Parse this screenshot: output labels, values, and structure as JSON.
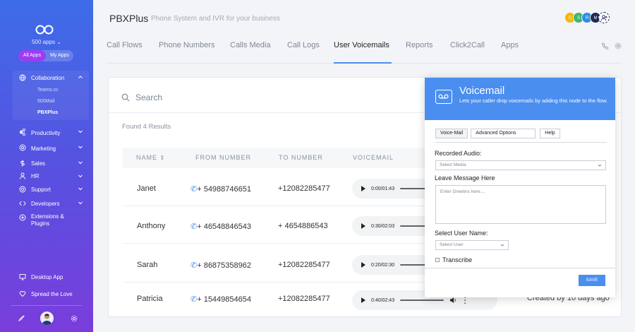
{
  "sidebar": {
    "apps_label": "500 apps",
    "pills": [
      "All Apps",
      "My Apps"
    ],
    "collaboration": "Collaboration",
    "collab_sub": [
      "Teams.cc",
      "500Mail",
      "PBXPlus"
    ],
    "items": [
      {
        "label": "Productivity",
        "icon": "command-icon"
      },
      {
        "label": "Marketing",
        "icon": "target-icon"
      },
      {
        "label": "Sales",
        "icon": "dollar-icon"
      },
      {
        "label": "HR",
        "icon": "user-icon"
      },
      {
        "label": "Support",
        "icon": "lifebuoy-icon"
      },
      {
        "label": "Developers",
        "icon": "code-icon"
      },
      {
        "label": "Extensions & Plugins",
        "icon": "puzzle-icon"
      }
    ],
    "bottom": [
      {
        "label": "Desktop App",
        "icon": "monitor-icon"
      },
      {
        "label": "Spread the Love",
        "icon": "heart-icon"
      }
    ]
  },
  "header": {
    "brand": "PBXPlus",
    "tagline": "Phone System and IVR for your business",
    "bubbles": [
      {
        "letter": "C",
        "color": "#f5b800"
      },
      {
        "letter": "S",
        "color": "#3fb66f"
      },
      {
        "letter": "R",
        "color": "#2e8de6"
      },
      {
        "letter": "M",
        "color": "#1f2a5a"
      }
    ]
  },
  "tabs": [
    "Call Flows",
    "Phone Numbers",
    "Calls Media",
    "Call Logs",
    "User Voicemails",
    "Reports",
    "Click2Call",
    "Apps"
  ],
  "main": {
    "search_placeholder": "Search",
    "results": "Found 4 Results",
    "columns": [
      "NAME",
      "FROM NUMBER",
      "TO NUMBER",
      "VOICEMAIL"
    ],
    "rows": [
      {
        "name": "Janet",
        "from": "+ 54988746651",
        "to": "+12082285477",
        "time": "0:00/01:43"
      },
      {
        "name": "Anthony",
        "from": "+ 46548846543",
        "to": "+ 4654886543",
        "time": "0:30/02:03"
      },
      {
        "name": "Sarah",
        "from": "+ 86875358962",
        "to": "+12082285477",
        "time": "0:20/02:30"
      },
      {
        "name": "Patricia",
        "from": "+ 15449854654",
        "to": "+12082285477",
        "time": "0:40/02:43"
      }
    ],
    "created": "Created by 10 days ago"
  },
  "voicemail": {
    "title": "Voicemail",
    "desc": "Lets your caller drop voicemails by adding this node to the flow.",
    "tabs": [
      "Voice-Mail",
      "Advanced Options",
      "Help"
    ],
    "recorded_label": "Recorded Audio:",
    "select_media": "Select Media",
    "leave_label": "Leave Message Here",
    "textarea_placeholder": "Enter Greetins here....",
    "user_label": "Select User Name:",
    "select_user": "Select User",
    "transcribe": "Transcribe",
    "save": "SAVE"
  }
}
